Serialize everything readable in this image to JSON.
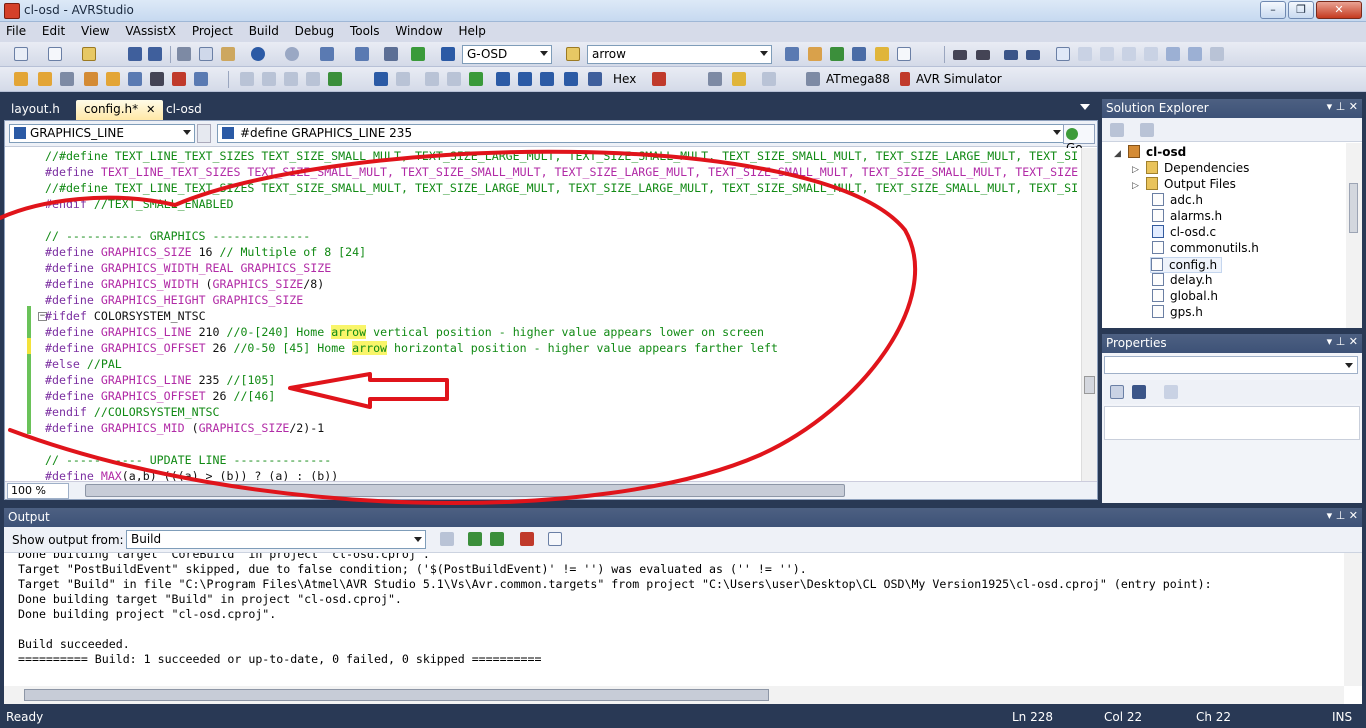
{
  "window": {
    "title": "cl-osd - AVRStudio",
    "buttons": {
      "minimize": "–",
      "restore": "❐",
      "close": "✕"
    }
  },
  "menu": [
    "File",
    "Edit",
    "View",
    "VAssistX",
    "Project",
    "Build",
    "Debug",
    "Tools",
    "Window",
    "Help"
  ],
  "toolbar": {
    "config_combo": "G-OSD",
    "find_combo": "arrow",
    "hex_label": "Hex",
    "device_label": "ATmega88",
    "tool_label": "AVR Simulator"
  },
  "tabs": [
    {
      "label": "layout.h"
    },
    {
      "label": "config.h*",
      "close": "✕"
    },
    {
      "label": "cl-osd"
    }
  ],
  "nav": {
    "scope": "GRAPHICS_LINE",
    "member": "#define GRAPHICS_LINE 235",
    "go_label": "Go"
  },
  "code": {
    "lines": [
      "//#define TEXT_LINE_TEXT_SIZES TEXT_SIZE_SMALL_MULT, TEXT_SIZE_LARGE_MULT, TEXT_SIZE_SMALL_MULT, TEXT_SIZE_SMALL_MULT, TEXT_SIZE_LARGE_MULT, TEXT_SI",
      "#define TEXT_LINE_TEXT_SIZES TEXT_SIZE_SMALL_MULT, TEXT_SIZE_SMALL_MULT, TEXT_SIZE_LARGE_MULT, TEXT_SIZE_SMALL_MULT, TEXT_SIZE_SMALL_MULT, TEXT_SIZE",
      "//#define TEXT_LINE_TEXT_SIZES TEXT_SIZE_SMALL_MULT, TEXT_SIZE_LARGE_MULT, TEXT_SIZE_LARGE_MULT, TEXT_SIZE_SMALL_MULT, TEXT_SIZE_SMALL_MULT, TEXT_SI",
      "#endif //TEXT_SMALL_ENABLED",
      "",
      "// ----------- GRAPHICS --------------",
      "#define GRAPHICS_SIZE 16 // Multiple of 8 [24]",
      "#define GRAPHICS_WIDTH_REAL GRAPHICS_SIZE",
      "#define GRAPHICS_WIDTH (GRAPHICS_SIZE/8)",
      "#define GRAPHICS_HEIGHT GRAPHICS_SIZE",
      "#ifdef COLORSYSTEM_NTSC",
      "#define GRAPHICS_LINE 210 //0-[240] Home arrow vertical position - higher value appears lower on screen",
      "#define GRAPHICS_OFFSET 26 //0-50 [45] Home arrow horizontal position - higher value appears farther left",
      "#else //PAL",
      "#define GRAPHICS_LINE 235 //[105]",
      "#define GRAPHICS_OFFSET 26 //[46]",
      "#endif //COLORSYSTEM_NTSC",
      "#define GRAPHICS_MID (GRAPHICS_SIZE/2)-1",
      "",
      "// ----------- UPDATE LINE --------------",
      "#define MAX(a,b) (((a) > (b)) ? (a) : (b))"
    ],
    "zoom": "100 %"
  },
  "solution_explorer": {
    "title": "Solution Explorer",
    "items": [
      "cl-osd",
      "Dependencies",
      "Output Files",
      "adc.h",
      "alarms.h",
      "cl-osd.c",
      "commonutils.h",
      "config.h",
      "delay.h",
      "global.h",
      "gps.h"
    ]
  },
  "properties": {
    "title": "Properties"
  },
  "output": {
    "title": "Output",
    "show_label": "Show output from:",
    "source": "Build",
    "lines": [
      "Done building target \"CoreBuild\" in project \"cl-osd.cproj\".",
      "Target \"PostBuildEvent\" skipped, due to false condition; ('$(PostBuildEvent)' != '') was evaluated as ('' != '').",
      "Target \"Build\" in file \"C:\\Program Files\\Atmel\\AVR Studio 5.1\\Vs\\Avr.common.targets\" from project \"C:\\Users\\user\\Desktop\\CL OSD\\My Version1925\\cl-osd.cproj\" (entry point):",
      "Done building target \"Build\" in project \"cl-osd.cproj\".",
      "Done building project \"cl-osd.cproj\".",
      "",
      "Build succeeded.",
      "========== Build: 1 succeeded or up-to-date, 0 failed, 0 skipped =========="
    ]
  },
  "status": {
    "ready": "Ready",
    "ln": "Ln 228",
    "col": "Col 22",
    "ch": "Ch 22",
    "mode": "INS"
  },
  "colors": {
    "chrome": "#293955",
    "annotation": "#e0141b",
    "highlight": "#f9f56a"
  }
}
